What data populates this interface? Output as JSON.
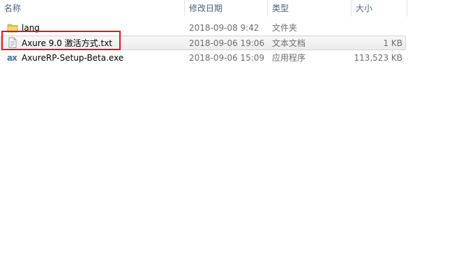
{
  "columns": {
    "name": "名称",
    "date_modified": "修改日期",
    "type": "类型",
    "size": "大小"
  },
  "files": [
    {
      "name": "lang",
      "date_modified": "2018-09-08 9:42",
      "type": "文件夹",
      "size": "",
      "icon": "folder-icon"
    },
    {
      "name": "Axure 9.0 激活方式.txt",
      "date_modified": "2018-09-06 19:06",
      "type": "文本文档",
      "size": "1 KB",
      "icon": "text-file-icon",
      "selected": true,
      "highlighted": true
    },
    {
      "name": "AxureRP-Setup-Beta.exe",
      "date_modified": "2018-09-06 15:09",
      "type": "应用程序",
      "size": "113,523 KB",
      "icon": "axure-app-icon",
      "icon_text": "ax"
    }
  ],
  "colors": {
    "header_text": "#4c607a",
    "detail_text": "#6d6d6d",
    "highlight_border": "#e0141e",
    "folder": "#e8c45a",
    "axure_icon": "#4a6f9c"
  }
}
